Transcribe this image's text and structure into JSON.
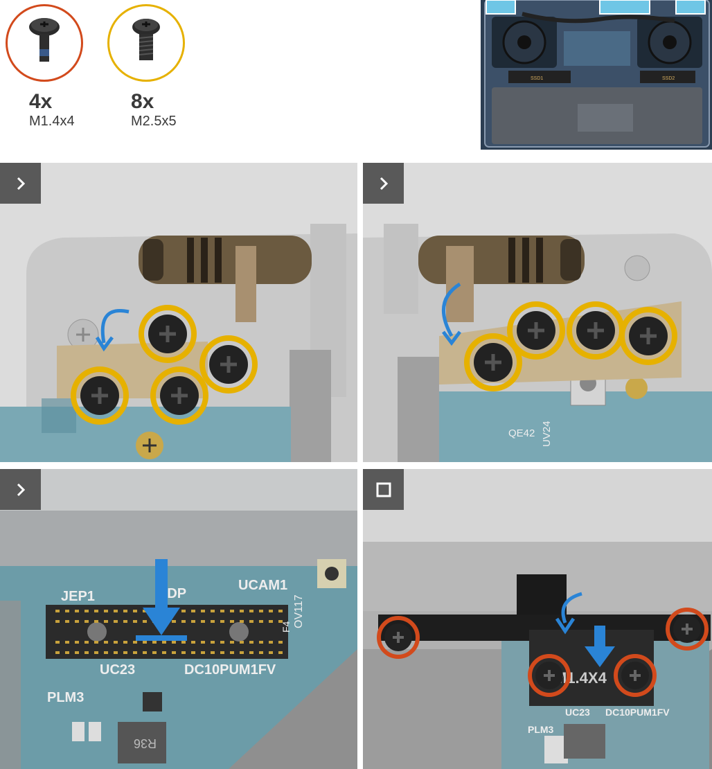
{
  "screws": [
    {
      "qty": "4x",
      "size": "M1.4x4",
      "ring_color": "#d24a1c"
    },
    {
      "qty": "8x",
      "size": "M2.5x5",
      "ring_color": "#e6b100"
    }
  ],
  "overview": {
    "ssd1_label": "SSD1",
    "ssd2_label": "SSD2"
  },
  "panels": [
    {
      "badge_icon": "chevron-right-icon"
    },
    {
      "badge_icon": "chevron-right-icon"
    },
    {
      "badge_icon": "chevron-right-icon",
      "labels": {
        "jep": "JEP1",
        "edp": "EDP",
        "ucam": "UCAM1",
        "ov": "OV117",
        "uc23": "UC23",
        "dc": "DC10PUM1FV",
        "plm": "PLM3",
        "r36": "R36",
        "f4": "F4"
      }
    },
    {
      "badge_icon": "stop-square-icon",
      "labels": {
        "plm": "PLM3",
        "uc23": "UC23",
        "dc": "DC10PUM1FV",
        "m14": "M1.4X4"
      }
    }
  ],
  "board_labels": {
    "qe42": "QE42",
    "uv24": "UV24"
  }
}
